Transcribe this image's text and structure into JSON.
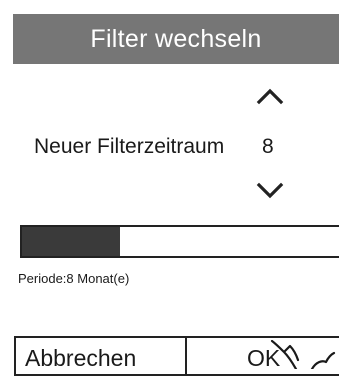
{
  "dialog": {
    "title": "Filter wechseln",
    "setting_label": "Neuer Filterzeitraum",
    "setting_value": "8",
    "progress_fraction": 0.31,
    "period_text": "Periode:8  Monat(e)"
  },
  "buttons": {
    "cancel_label": "Abbrechen",
    "ok_label": "OK"
  },
  "icons": {
    "increase": "chevron-up-icon",
    "decrease": "chevron-down-icon",
    "pointer": "hand-cursor-icon"
  },
  "colors": {
    "title_bar": "#767676",
    "progress_fill": "#3a3a3a"
  }
}
